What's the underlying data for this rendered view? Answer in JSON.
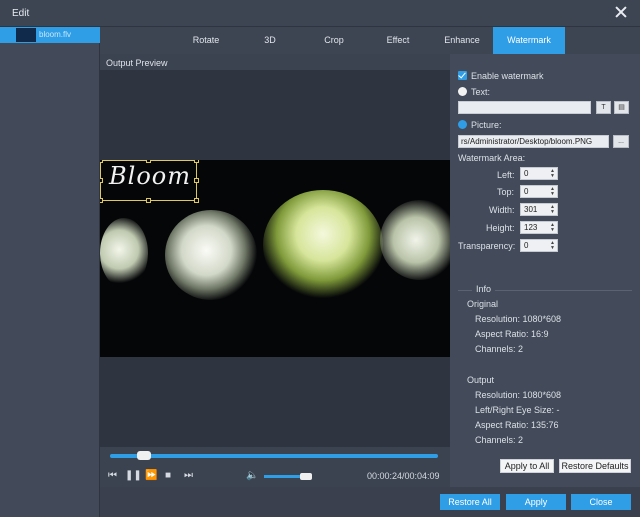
{
  "window": {
    "title": "Edit"
  },
  "sidebar": {
    "file_name": "bloom.flv"
  },
  "tabs": [
    {
      "label": "Rotate"
    },
    {
      "label": "3D"
    },
    {
      "label": "Crop"
    },
    {
      "label": "Effect"
    },
    {
      "label": "Enhance"
    },
    {
      "label": "Watermark",
      "active": true
    }
  ],
  "preview": {
    "label": "Output Preview",
    "watermark_text": "Bloom"
  },
  "player": {
    "timecode": "00:00:24/00:04:09",
    "progress": 0.1,
    "volume": 0.8
  },
  "watermark": {
    "enable_label": "Enable watermark",
    "enabled": true,
    "text_label": "Text:",
    "text_value": "",
    "picture_label": "Picture:",
    "picture_path": "rs/Administrator/Desktop/bloom.PNG",
    "browse_label": "...",
    "area_label": "Watermark Area:",
    "left_label": "Left:",
    "left_value": "0",
    "top_label": "Top:",
    "top_value": "0",
    "width_label": "Width:",
    "width_value": "301",
    "height_label": "Height:",
    "height_value": "123",
    "transparency_label": "Transparency:",
    "transparency_value": "0"
  },
  "info": {
    "title": "Info",
    "original_label": "Original",
    "original_resolution": "Resolution: 1080*608",
    "original_aspect": "Aspect Ratio: 16:9",
    "original_channels": "Channels: 2",
    "output_label": "Output",
    "output_resolution": "Resolution: 1080*608",
    "output_eye": "Left/Right Eye Size: -",
    "output_aspect": "Aspect Ratio: 135:76",
    "output_channels": "Channels: 2"
  },
  "buttons": {
    "apply_to_all": "Apply to All",
    "restore_defaults": "Restore Defaults",
    "restore_all": "Restore All",
    "apply": "Apply",
    "close": "Close"
  },
  "colors": {
    "accent": "#2f9ee6",
    "background": "#3b4250",
    "panel": "#434a59"
  }
}
